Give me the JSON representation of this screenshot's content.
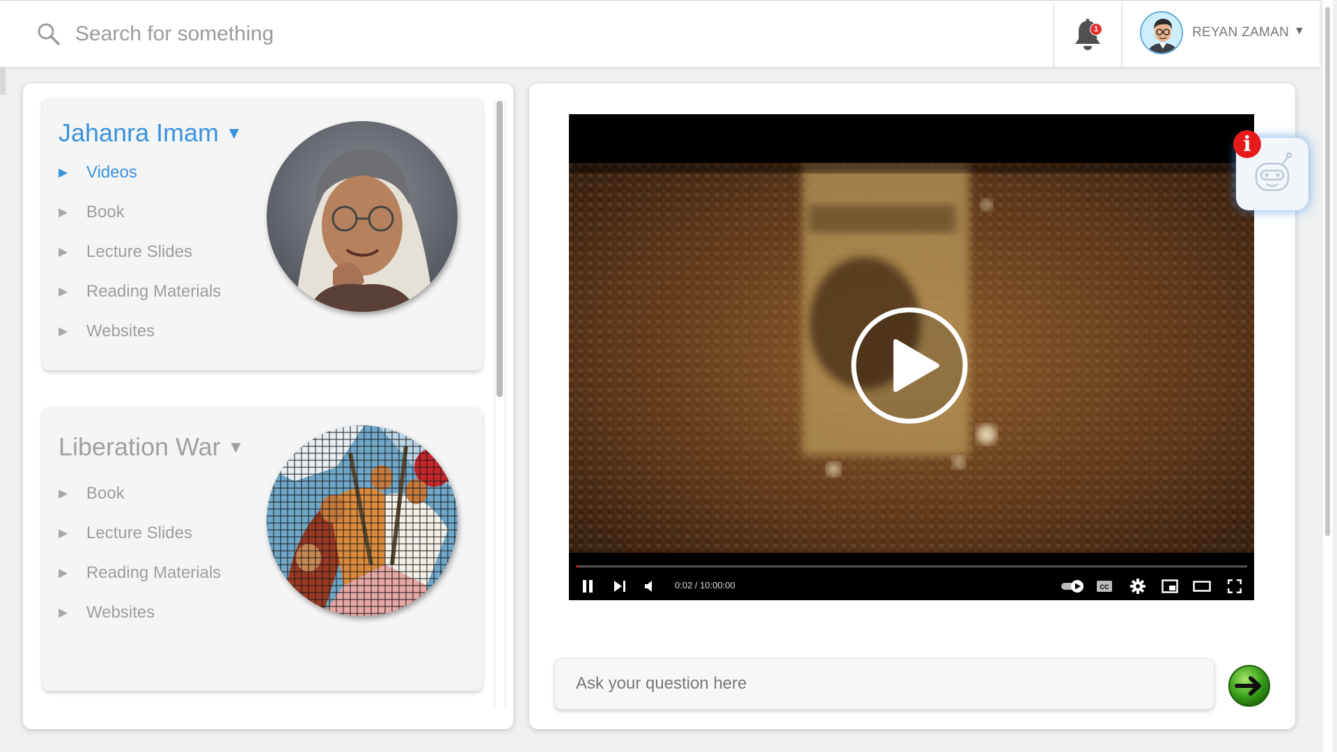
{
  "header": {
    "search_placeholder": "Search for something",
    "notification_count": "1",
    "user_name": "REYAN ZAMAN",
    "user_caret": "▼"
  },
  "topics": [
    {
      "title": "Jahanra Imam",
      "caret": "▼",
      "active": true,
      "items": [
        {
          "label": "Videos",
          "active": true
        },
        {
          "label": "Book"
        },
        {
          "label": "Lecture Slides"
        },
        {
          "label": "Reading Materials"
        },
        {
          "label": "Websites"
        }
      ]
    },
    {
      "title": "Liberation War",
      "caret": "▼",
      "items": [
        {
          "label": "Book"
        },
        {
          "label": "Lecture Slides"
        },
        {
          "label": "Reading Materials"
        },
        {
          "label": "Websites"
        }
      ]
    }
  ],
  "video": {
    "time_display": "0:02 / 10:00:00",
    "progress": 0.0
  },
  "assistant": {
    "badge": "i"
  },
  "chat": {
    "ask_placeholder": "Ask your question here"
  },
  "colors": {
    "accent": "#3a93de",
    "muted_text": "#9e9e9e",
    "badge_red": "#e51b1b",
    "send_green": "#3fa51e"
  }
}
